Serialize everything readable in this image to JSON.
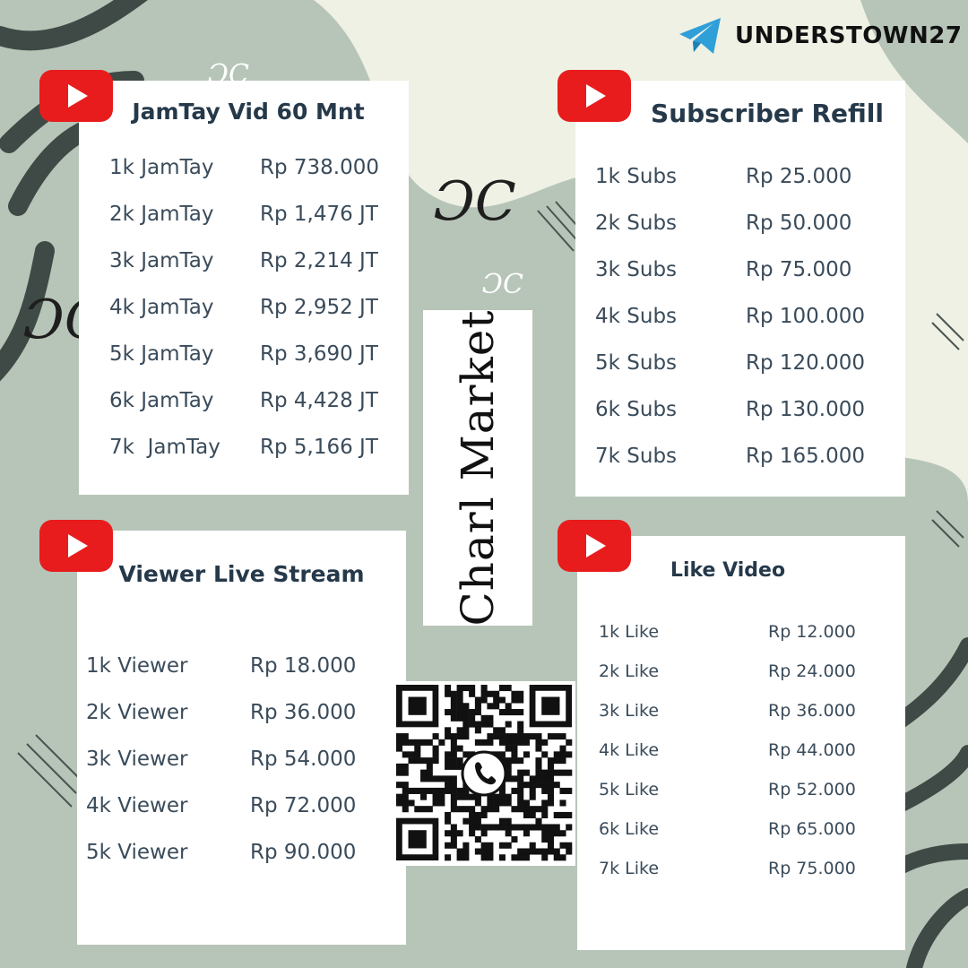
{
  "brand": {
    "name": "UNDERSTOWN27",
    "icon": "telegram-icon"
  },
  "market": {
    "name": "Charl Market"
  },
  "cards": {
    "jamtay": {
      "title": "JamTay Vid 60 Mnt",
      "rows": [
        {
          "label": "1k JamTay",
          "price": "Rp 738.000"
        },
        {
          "label": "2k JamTay",
          "price": "Rp 1,476 JT"
        },
        {
          "label": "3k JamTay",
          "price": "Rp 2,214 JT"
        },
        {
          "label": "4k JamTay",
          "price": "Rp 2,952 JT"
        },
        {
          "label": "5k JamTay",
          "price": "Rp 3,690 JT"
        },
        {
          "label": "6k JamTay",
          "price": "Rp 4,428 JT"
        },
        {
          "label": "7k  JamTay",
          "price": "Rp 5,166 JT"
        }
      ]
    },
    "subs": {
      "title": "Subscriber Refill",
      "rows": [
        {
          "label": "1k Subs",
          "price": "Rp 25.000"
        },
        {
          "label": "2k Subs",
          "price": "Rp 50.000"
        },
        {
          "label": "3k Subs",
          "price": "Rp 75.000"
        },
        {
          "label": "4k Subs",
          "price": "Rp 100.000"
        },
        {
          "label": "5k Subs",
          "price": "Rp 120.000"
        },
        {
          "label": "6k Subs",
          "price": "Rp 130.000"
        },
        {
          "label": "7k Subs",
          "price": "Rp 165.000"
        }
      ]
    },
    "viewer": {
      "title": "Viewer Live Stream",
      "rows": [
        {
          "label": "1k Viewer",
          "price": "Rp 18.000"
        },
        {
          "label": "2k Viewer",
          "price": "Rp 36.000"
        },
        {
          "label": "3k Viewer",
          "price": "Rp 54.000"
        },
        {
          "label": "4k Viewer",
          "price": "Rp 72.000"
        },
        {
          "label": "5k Viewer",
          "price": "Rp 90.000"
        }
      ]
    },
    "like": {
      "title": "Like Video",
      "rows": [
        {
          "label": "1k Like",
          "price": "Rp 12.000"
        },
        {
          "label": "2k Like",
          "price": "Rp 24.000"
        },
        {
          "label": "3k Like",
          "price": "Rp 36.000"
        },
        {
          "label": "4k Like",
          "price": "Rp 44.000"
        },
        {
          "label": "5k Like",
          "price": "Rp 52.000"
        },
        {
          "label": "6k Like",
          "price": "Rp 65.000"
        },
        {
          "label": "7k Like",
          "price": "Rp 75.000"
        }
      ]
    }
  },
  "colors": {
    "youtube_red": "#e81c1c",
    "title_navy": "#25394a",
    "sage": "#b8c6bb",
    "leaf": "#3e4b47"
  },
  "icons": [
    "youtube-icon",
    "telegram-icon",
    "qr-code-icon",
    "whatsapp-icon",
    "flourish-monogram-icon"
  ]
}
